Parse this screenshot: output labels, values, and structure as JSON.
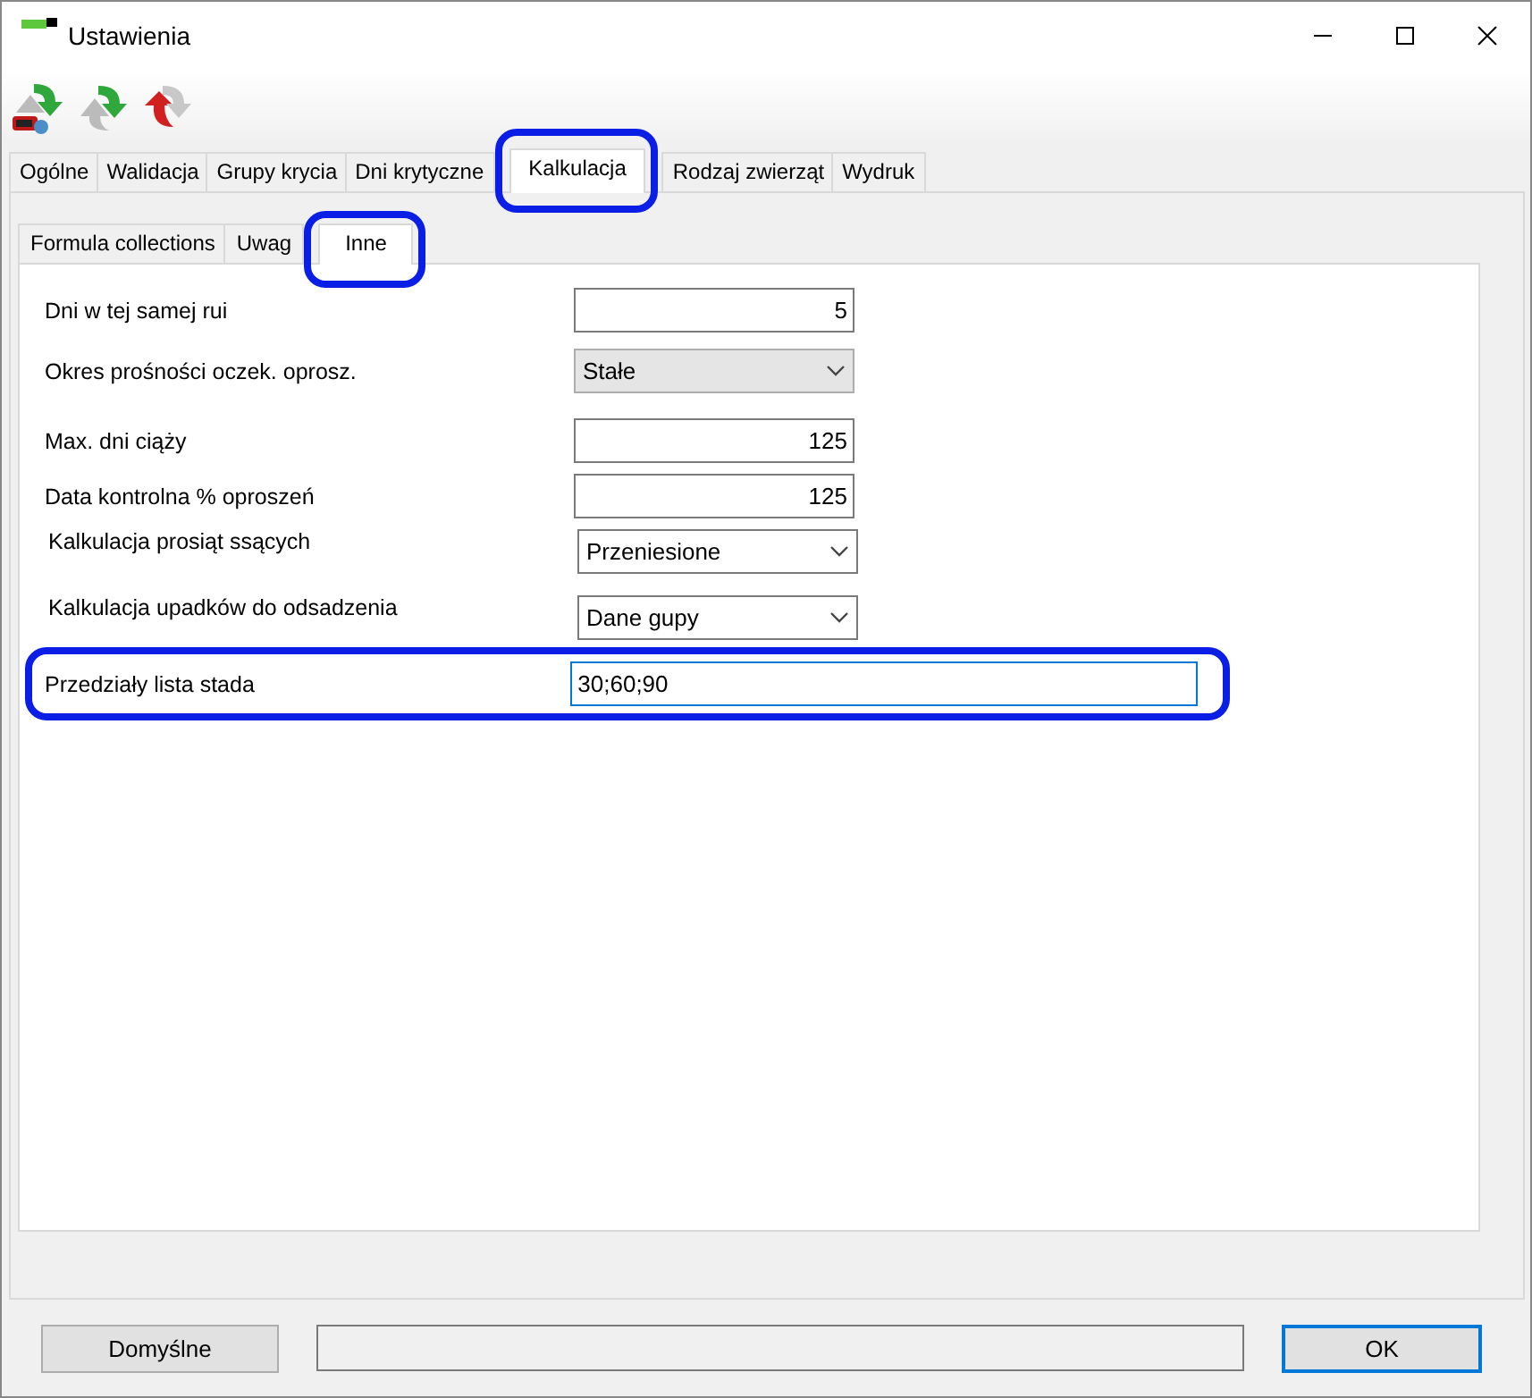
{
  "window": {
    "title": "Ustawienia"
  },
  "tabs": [
    {
      "label": "Ogólne",
      "selected": false,
      "highlighted": false
    },
    {
      "label": "Walidacja",
      "selected": false,
      "highlighted": false
    },
    {
      "label": "Grupy krycia",
      "selected": false,
      "highlighted": false
    },
    {
      "label": "Dni krytyczne",
      "selected": false,
      "highlighted": false
    },
    {
      "label": "Kalkulacja",
      "selected": true,
      "highlighted": true
    },
    {
      "label": "Rodzaj zwierząt",
      "selected": false,
      "highlighted": false
    },
    {
      "label": "Wydruk",
      "selected": false,
      "highlighted": false
    }
  ],
  "subtabs": [
    {
      "label": "Formula collections",
      "selected": false,
      "highlighted": false
    },
    {
      "label": "Uwag",
      "selected": false,
      "highlighted": false
    },
    {
      "label": "Inne",
      "selected": true,
      "highlighted": true
    }
  ],
  "fields": [
    {
      "label": "Dni w tej samej rui",
      "kind": "number",
      "value": "5",
      "highlighted": false
    },
    {
      "label": "Okres prośności oczek. oprosz.",
      "kind": "list",
      "value": "Stałe",
      "highlighted": false
    },
    {
      "label": "Max. dni ciąży",
      "kind": "number",
      "value": "125",
      "highlighted": false
    },
    {
      "label": "Data kontrolna % oproszeń",
      "kind": "number",
      "value": "125",
      "highlighted": false
    },
    {
      "label": "Kalkulacja prosiąt ssących",
      "kind": "combo",
      "value": "Przeniesione",
      "highlighted": false
    },
    {
      "label": "Kalkulacja upadków do odsadzenia",
      "kind": "combo",
      "value": "Dane gupy",
      "highlighted": false
    },
    {
      "label": "Przedziały lista stada",
      "kind": "text",
      "value": "30;60;90",
      "highlighted": true
    }
  ],
  "buttons": {
    "defaults": "Domyślne",
    "ok": "OK"
  }
}
